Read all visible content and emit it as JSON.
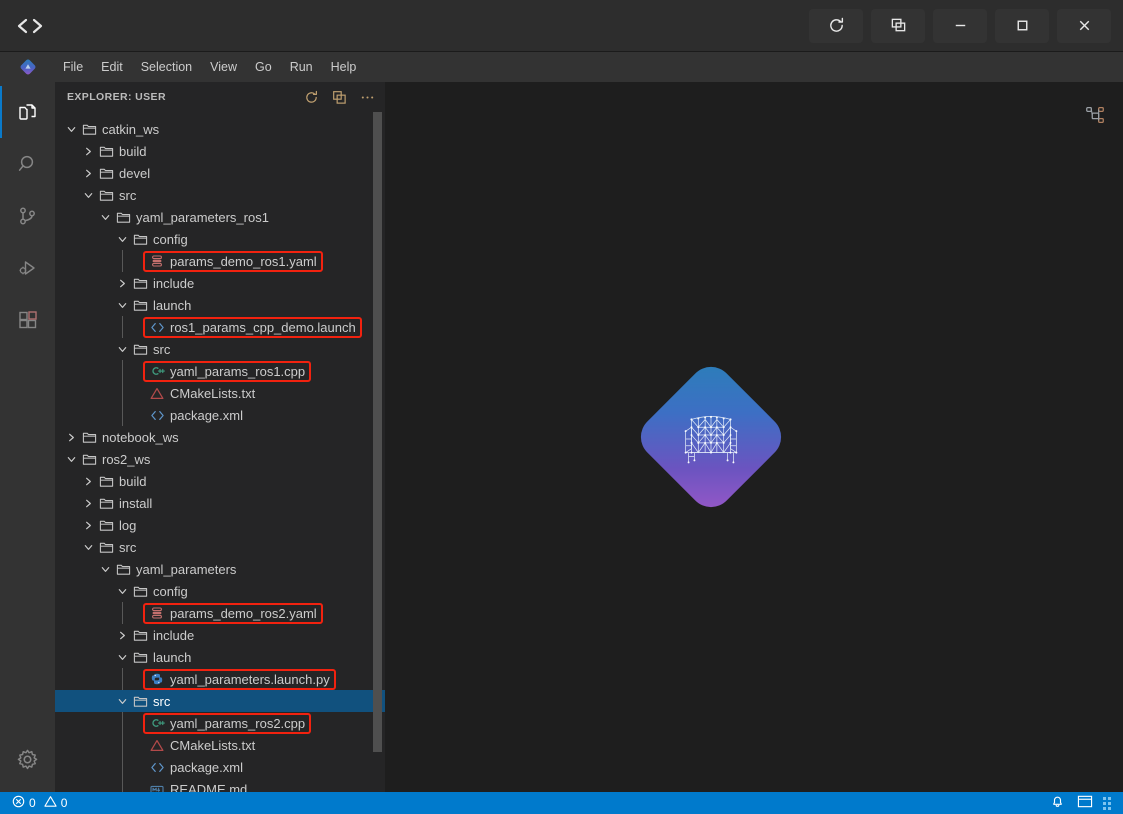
{
  "titlebar": {
    "logo_icon": "code-brackets-icon",
    "buttons": [
      {
        "name": "refresh-button",
        "icon": "refresh-icon"
      },
      {
        "name": "duplicate-window-button",
        "icon": "windows-stack-icon"
      },
      {
        "name": "minimize-button",
        "icon": "minimize-icon"
      },
      {
        "name": "maximize-button",
        "icon": "maximize-icon"
      },
      {
        "name": "close-button",
        "icon": "close-icon"
      }
    ]
  },
  "menubar": {
    "logo_icon": "theia-diamond-icon",
    "items": [
      {
        "label": "File"
      },
      {
        "label": "Edit"
      },
      {
        "label": "Selection"
      },
      {
        "label": "View"
      },
      {
        "label": "Go"
      },
      {
        "label": "Run"
      },
      {
        "label": "Help"
      }
    ]
  },
  "activitybar": {
    "items": [
      {
        "name": "sidebar-item-explorer",
        "icon": "files-icon",
        "active": true
      },
      {
        "name": "sidebar-item-search",
        "icon": "search-icon",
        "active": false
      },
      {
        "name": "sidebar-item-source-control",
        "icon": "source-control-icon",
        "active": false
      },
      {
        "name": "sidebar-item-run-debug",
        "icon": "run-debug-icon",
        "active": false
      },
      {
        "name": "sidebar-item-extensions",
        "icon": "extensions-icon",
        "active": false
      }
    ],
    "bottom": [
      {
        "name": "settings-gear-button",
        "icon": "gear-icon"
      }
    ]
  },
  "explorer": {
    "title": "EXPLORER: USER",
    "header_icons": [
      {
        "name": "refresh-explorer-icon",
        "icon": "refresh-icon"
      },
      {
        "name": "collapse-all-icon",
        "icon": "collapse-all-icon"
      },
      {
        "name": "explorer-more-actions-icon",
        "icon": "ellipsis-icon"
      }
    ],
    "tree": [
      {
        "label": "catkin_ws",
        "depth": 0,
        "type": "folder",
        "state": "expanded",
        "highlighted": false
      },
      {
        "label": "build",
        "depth": 1,
        "type": "folder",
        "state": "collapsed",
        "highlighted": false
      },
      {
        "label": "devel",
        "depth": 1,
        "type": "folder",
        "state": "collapsed",
        "highlighted": false
      },
      {
        "label": "src",
        "depth": 1,
        "type": "folder",
        "state": "expanded",
        "highlighted": false
      },
      {
        "label": "yaml_parameters_ros1",
        "depth": 2,
        "type": "folder",
        "state": "expanded",
        "highlighted": false
      },
      {
        "label": "config",
        "depth": 3,
        "type": "folder",
        "state": "expanded",
        "highlighted": false
      },
      {
        "label": "params_demo_ros1.yaml",
        "depth": 4,
        "type": "yaml",
        "state": "leaf",
        "highlighted": true
      },
      {
        "label": "include",
        "depth": 3,
        "type": "folder",
        "state": "collapsed",
        "highlighted": false
      },
      {
        "label": "launch",
        "depth": 3,
        "type": "folder",
        "state": "expanded",
        "highlighted": false
      },
      {
        "label": "ros1_params_cpp_demo.launch",
        "depth": 4,
        "type": "xml",
        "state": "leaf",
        "highlighted": true
      },
      {
        "label": "src",
        "depth": 3,
        "type": "folder",
        "state": "expanded",
        "highlighted": false
      },
      {
        "label": "yaml_params_ros1.cpp",
        "depth": 4,
        "type": "cpp",
        "state": "leaf",
        "highlighted": true
      },
      {
        "label": "CMakeLists.txt",
        "depth": 4,
        "type": "cmake",
        "state": "leaf",
        "highlighted": false
      },
      {
        "label": "package.xml",
        "depth": 4,
        "type": "xml",
        "state": "leaf",
        "highlighted": false
      },
      {
        "label": "notebook_ws",
        "depth": 0,
        "type": "folder",
        "state": "collapsed",
        "highlighted": false
      },
      {
        "label": "ros2_ws",
        "depth": 0,
        "type": "folder",
        "state": "expanded",
        "highlighted": false
      },
      {
        "label": "build",
        "depth": 1,
        "type": "folder",
        "state": "collapsed",
        "highlighted": false
      },
      {
        "label": "install",
        "depth": 1,
        "type": "folder",
        "state": "collapsed",
        "highlighted": false
      },
      {
        "label": "log",
        "depth": 1,
        "type": "folder",
        "state": "collapsed",
        "highlighted": false
      },
      {
        "label": "src",
        "depth": 1,
        "type": "folder",
        "state": "expanded",
        "highlighted": false
      },
      {
        "label": "yaml_parameters",
        "depth": 2,
        "type": "folder",
        "state": "expanded",
        "highlighted": false
      },
      {
        "label": "config",
        "depth": 3,
        "type": "folder",
        "state": "expanded",
        "highlighted": false
      },
      {
        "label": "params_demo_ros2.yaml",
        "depth": 4,
        "type": "yaml",
        "state": "leaf",
        "highlighted": true
      },
      {
        "label": "include",
        "depth": 3,
        "type": "folder",
        "state": "collapsed",
        "highlighted": false
      },
      {
        "label": "launch",
        "depth": 3,
        "type": "folder",
        "state": "expanded",
        "highlighted": false
      },
      {
        "label": "yaml_parameters.launch.py",
        "depth": 4,
        "type": "py",
        "state": "leaf",
        "highlighted": true
      },
      {
        "label": "src",
        "depth": 3,
        "type": "folder",
        "state": "expanded",
        "highlighted": false,
        "selected": true
      },
      {
        "label": "yaml_params_ros2.cpp",
        "depth": 4,
        "type": "cpp",
        "state": "leaf",
        "highlighted": true
      },
      {
        "label": "CMakeLists.txt",
        "depth": 4,
        "type": "cmake",
        "state": "leaf",
        "highlighted": false
      },
      {
        "label": "package.xml",
        "depth": 4,
        "type": "xml",
        "state": "leaf",
        "highlighted": false
      },
      {
        "label": "README.md",
        "depth": 4,
        "type": "md",
        "state": "leaf",
        "highlighted": false
      }
    ]
  },
  "editor": {
    "watermark_icon": "theia-armchair-logo",
    "outline_icon": "outline-hierarchy-icon"
  },
  "statusbar": {
    "errors_icon": "error-circle-icon",
    "errors_count": "0",
    "warnings_icon": "warning-triangle-icon",
    "warnings_count": "0",
    "notifications_icon": "bell-icon",
    "layout_icon": "panel-layout-icon"
  },
  "colors": {
    "accent": "#007acc",
    "highlight_box": "#f2220f",
    "selection": "#11517e",
    "titlebar_bg": "#2d2d2d",
    "menubar_bg": "#333333",
    "sidebar_bg": "#252526",
    "editor_bg": "#1e1e1e"
  }
}
